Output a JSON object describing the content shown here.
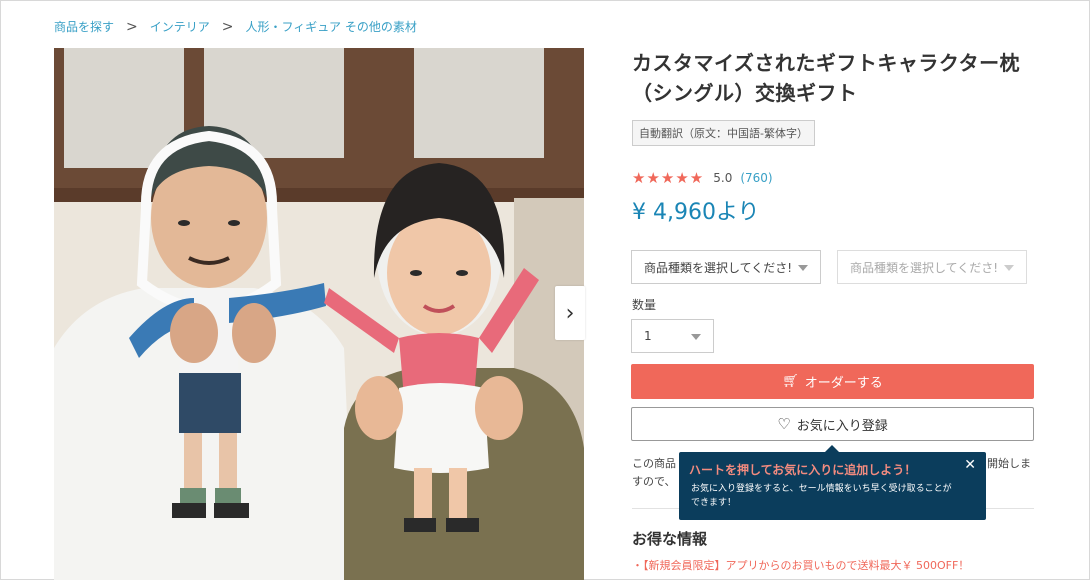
{
  "breadcrumb": {
    "items": [
      "商品を探す",
      "インテリア",
      "人形・フィギュア その他の素材"
    ],
    "separator": ">"
  },
  "product": {
    "title": "カスタマイズされたギフトキャラクター枕（シングル）交換ギフト",
    "translation_badge": "自動翻訳（原文：中国語-繁体字）",
    "rating_stars": "★★★★★",
    "rating_score": "5.0",
    "rating_count": "(760)",
    "price": "¥ 4,960より"
  },
  "options": {
    "variant1_placeholder": "商品種類を選択してくださ!",
    "variant2_placeholder": "商品種類を選択してくださ!",
    "quantity_label": "数量",
    "quantity_value": "1"
  },
  "actions": {
    "order_label": "オーダーする",
    "favorite_label": "お気に入り登録"
  },
  "notice": {
    "line1_left": "この商品",
    "line1_right": "開始しま",
    "line2": "すので、"
  },
  "tooltip": {
    "title": "ハートを押してお気に入りに追加しよう！",
    "body": "お気に入り登録をすると、セール情報をいち早く受け取ることができます！",
    "close": "✕"
  },
  "deals": {
    "title": "お得な情報",
    "item1": "・【新規会員限定】アプリからのお買いもので送料最大￥ 500OFF！"
  },
  "colors": {
    "accent": "#f0685a",
    "link": "#39a0c6",
    "price": "#1a85b5",
    "tooltip_bg": "#0b3d5c"
  },
  "icons": {
    "next": "chevron-right-icon",
    "cart": "cart-icon",
    "heart": "heart-outline-icon"
  }
}
